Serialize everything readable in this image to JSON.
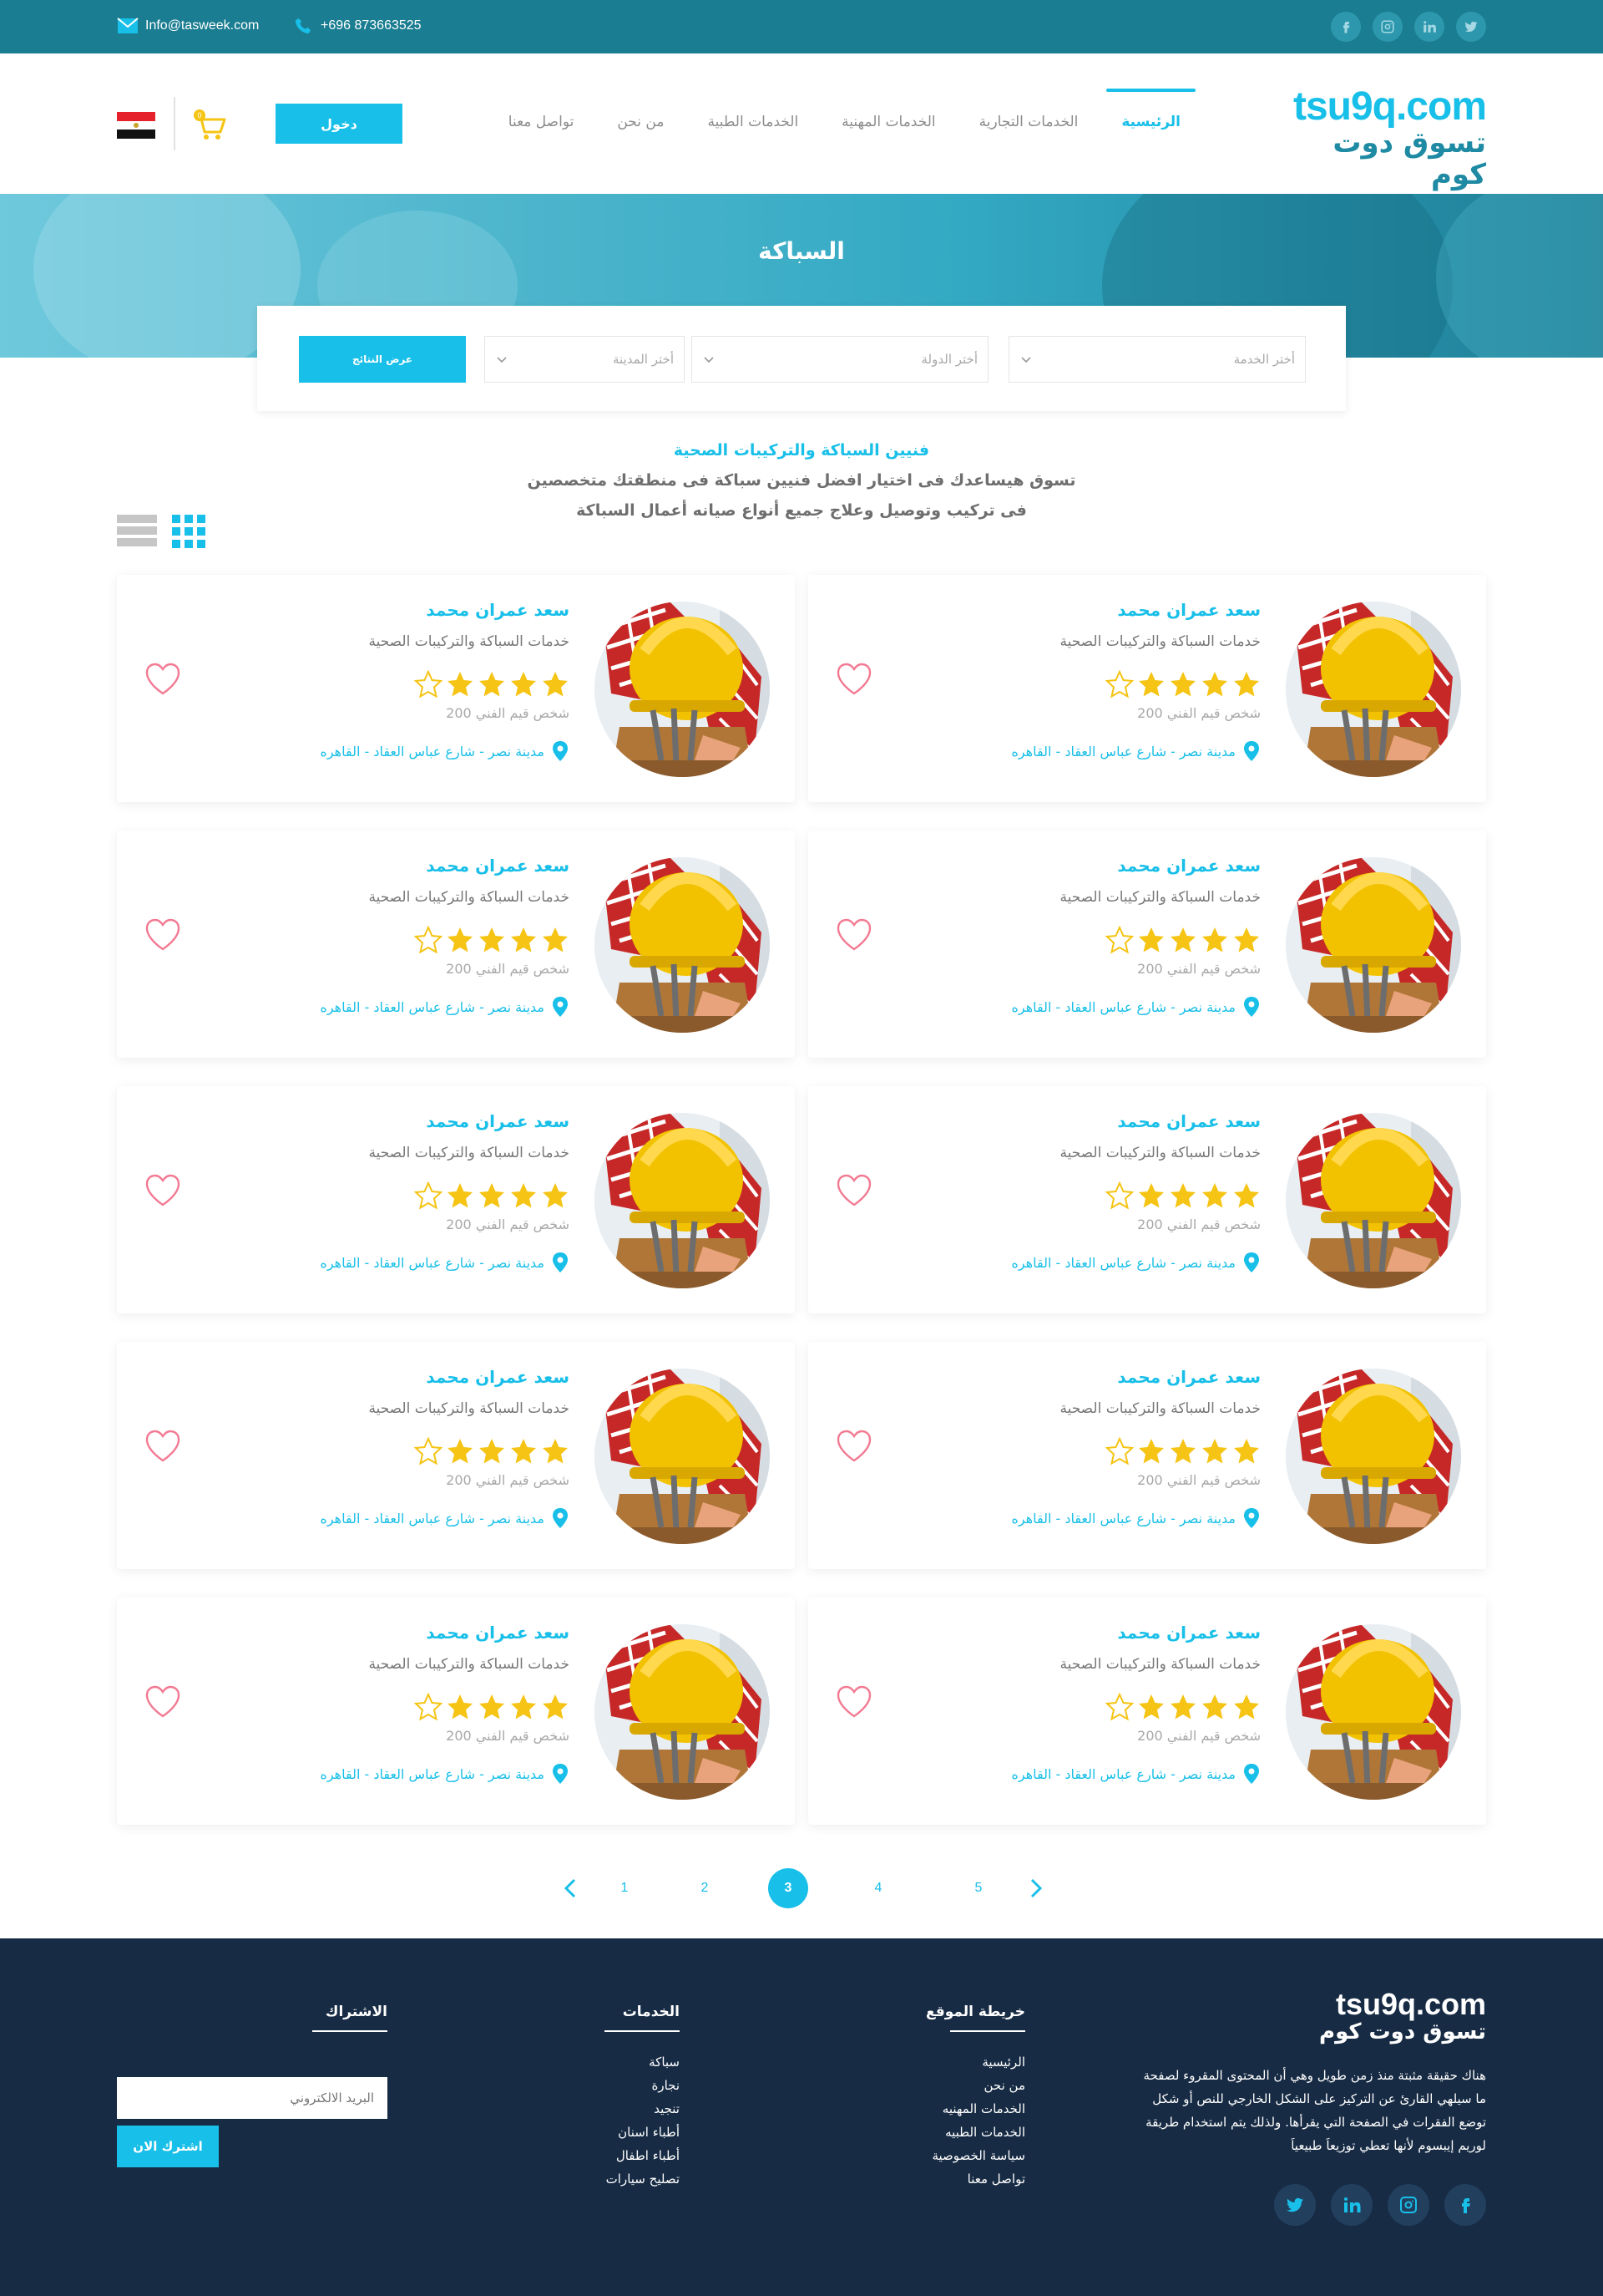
{
  "topbar": {
    "email": "Info@tasweek.com",
    "phone": "+696 873663525",
    "social": [
      "facebook-icon",
      "instagram-icon",
      "linkedin-icon",
      "twitter-icon"
    ]
  },
  "header": {
    "logo_en": "tsu9q.com",
    "logo_ar": "تسوق دوت كوم",
    "nav": [
      {
        "label": "الرئيسية",
        "active": true
      },
      {
        "label": "الخدمات التجارية",
        "active": false
      },
      {
        "label": "الخدمات المهنية",
        "active": false
      },
      {
        "label": "الخدمات الطبية",
        "active": false
      },
      {
        "label": "من نحن",
        "active": false
      },
      {
        "label": "تواصل معنا",
        "active": false
      }
    ],
    "login_label": "دخول",
    "cart_count": "0"
  },
  "hero": {
    "title": "السباكة"
  },
  "search": {
    "service_placeholder": "أختر الخدمة",
    "country_placeholder": "أختر الدولة",
    "city_placeholder": "أختر المدينة",
    "submit_label": "عرض النتائج"
  },
  "intro": {
    "heading": "فنيين السباكة والتركيبات الصحية",
    "line1": "تسوق هيساعدك فى اختيار افضل فنيين سباكة فى منطقتك متخصصين",
    "line2": "فى تركيب وتوصيل وعلاج جميع أنواع صيانه أعمال السباكة"
  },
  "cards": [
    {
      "name": "سعد عمران محمد",
      "service": "خدمات السباكة والتركيبات الصحية",
      "rating": 4,
      "raters": "شخص قيم الفني 200",
      "location": "مدينة نصر - شارع عباس العقاد - القاهره"
    },
    {
      "name": "سعد عمران محمد",
      "service": "خدمات السباكة والتركيبات الصحية",
      "rating": 4,
      "raters": "شخص قيم الفني 200",
      "location": "مدينة نصر - شارع عباس العقاد - القاهره"
    },
    {
      "name": "سعد عمران محمد",
      "service": "خدمات السباكة والتركيبات الصحية",
      "rating": 4,
      "raters": "شخص قيم الفني 200",
      "location": "مدينة نصر - شارع عباس العقاد - القاهره"
    },
    {
      "name": "سعد عمران محمد",
      "service": "خدمات السباكة والتركيبات الصحية",
      "rating": 4,
      "raters": "شخص قيم الفني 200",
      "location": "مدينة نصر - شارع عباس العقاد - القاهره"
    },
    {
      "name": "سعد عمران محمد",
      "service": "خدمات السباكة والتركيبات الصحية",
      "rating": 4,
      "raters": "شخص قيم الفني 200",
      "location": "مدينة نصر - شارع عباس العقاد - القاهره"
    },
    {
      "name": "سعد عمران محمد",
      "service": "خدمات السباكة والتركيبات الصحية",
      "rating": 4,
      "raters": "شخص قيم الفني 200",
      "location": "مدينة نصر - شارع عباس العقاد - القاهره"
    },
    {
      "name": "سعد عمران محمد",
      "service": "خدمات السباكة والتركيبات الصحية",
      "rating": 4,
      "raters": "شخص قيم الفني 200",
      "location": "مدينة نصر - شارع عباس العقاد - القاهره"
    },
    {
      "name": "سعد عمران محمد",
      "service": "خدمات السباكة والتركيبات الصحية",
      "rating": 4,
      "raters": "شخص قيم الفني 200",
      "location": "مدينة نصر - شارع عباس العقاد - القاهره"
    },
    {
      "name": "سعد عمران محمد",
      "service": "خدمات السباكة والتركيبات الصحية",
      "rating": 4,
      "raters": "شخص قيم الفني 200",
      "location": "مدينة نصر - شارع عباس العقاد - القاهره"
    },
    {
      "name": "سعد عمران محمد",
      "service": "خدمات السباكة والتركيبات الصحية",
      "rating": 4,
      "raters": "شخص قيم الفني 200",
      "location": "مدينة نصر - شارع عباس العقاد - القاهره"
    }
  ],
  "pagination": {
    "pages": [
      "1",
      "2",
      "3",
      "4",
      "5"
    ],
    "current": "3"
  },
  "footer": {
    "logo_en": "tsu9q.com",
    "logo_ar": "تسوق دوت كوم",
    "about": "هناك حقيقة مثبتة منذ زمن طويل وهي أن المحتوى المقروء لصفحة ما سيلهي القارئ عن التركيز على الشكل الخارجي للنص أو شكل توضع الفقرات في الصفحة التي يقرأها. ولذلك يتم استخدام طريقة لوريم إيبسوم لأنها تعطي توزيعاَ طبيعياَ",
    "sitemap_title": "خريطة الموقع",
    "sitemap": [
      "الرئيسية",
      "من نحن",
      "الخدمات المهنيه",
      "الخدمات الطبيه",
      "سياسة الخصوصية",
      "تواصل معنا"
    ],
    "services_title": "الخدمات",
    "services": [
      "سباكة",
      "نجارة",
      "تنجيد",
      "أطباء اسنان",
      "أطباء اطفال",
      "تصليح سيارات"
    ],
    "subscribe_title": "الاشتراك",
    "email_placeholder": "البريد الالكتروني",
    "subscribe_label": "اشترك الان"
  },
  "colors": {
    "accent": "#18bfe8",
    "topbar": "#1a7d91",
    "footer": "#172b44",
    "star": "#f5c414",
    "heart": "#f27a92"
  }
}
